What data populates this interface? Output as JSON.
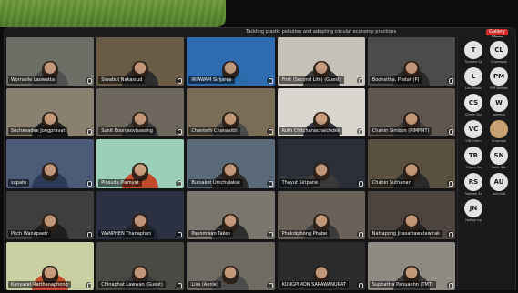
{
  "meeting": {
    "title": "Tackling plastic pollution and adopting circular economy practices",
    "view_label": "Gallery View"
  },
  "tiles": [
    {
      "name": "Worrasile Laowatta",
      "bg": "#6c6f66",
      "shirt": "#505050"
    },
    {
      "name": "Siwabut Nakasrud",
      "bg": "#6a5b47",
      "shirt": "#2d2d2d"
    },
    {
      "name": "IRIAWAM Sirijaree",
      "bg": "#2f6bb0",
      "shirt": "#2b6aa8"
    },
    {
      "name": "First (Second Life) (Guest)",
      "bg": "#c7c2b8",
      "shirt": "#3a3a3a"
    },
    {
      "name": "Boonsitha, Pratat (P)",
      "bg": "#4b4b4b",
      "shirt": "#2a2a2a"
    },
    {
      "name": "Suchavadee Jongpravat",
      "bg": "#8a8070",
      "shirt": "#1f1f1f"
    },
    {
      "name": "Sunit Boonjaovisasong",
      "bg": "#6e675e",
      "shirt": "#3c3c3c"
    },
    {
      "name": "Chanteth Chanakitti",
      "bg": "#7a6d58",
      "shirt": "#4a4a4a"
    },
    {
      "name": "Ruth Chitchanachaichoke",
      "bg": "#d9d6cf",
      "shirt": "#2f3440"
    },
    {
      "name": "Chanin Simbon (PIMPMT)",
      "bg": "#5f5650",
      "shirt": "#3a3a3a"
    },
    {
      "name": "supatn",
      "bg": "#4c5c78",
      "shirt": "#2c3a58"
    },
    {
      "name": "Pinsuda Plamyat",
      "bg": "#9ccfb8",
      "shirt": "#c04a2a"
    },
    {
      "name": "Butsakot Umchulakat",
      "bg": "#5a6a78",
      "shirt": "#2b2b2b"
    },
    {
      "name": "Thayut Siripane",
      "bg": "#2b2f37",
      "shirt": "#3a3a3a"
    },
    {
      "name": "Chanin Suthanan",
      "bg": "#5a5040",
      "shirt": "#2a2a2a"
    },
    {
      "name": "Pitch Wanapaetr",
      "bg": "#3e3e3e",
      "shirt": "#1e1e1e"
    },
    {
      "name": "WANPHEN Thanaphon",
      "bg": "#2b3142",
      "shirt": "#1e2430"
    },
    {
      "name": "Panomwan Takes",
      "bg": "#7b776f",
      "shirt": "#2d2d2d"
    },
    {
      "name": "Phakdiphong Phabe",
      "bg": "#6a6158",
      "shirt": "#3b3b3b"
    },
    {
      "name": "Nattapong Jirasattawatawirak",
      "bg": "#4e4540",
      "shirt": "#202020"
    },
    {
      "name": "Kanyarat Ratthanaphong",
      "bg": "#c9cfa0",
      "shirt": "#c64f2c"
    },
    {
      "name": "Chinaphat Lawwan (Guest)",
      "bg": "#4a4a44",
      "shirt": "#3a3a3a"
    },
    {
      "name": "Lisa (Annie)",
      "bg": "#6f6a62",
      "shirt": "#4b4b4b"
    },
    {
      "name": "KUNGPIMON SARAWANURAT",
      "bg": "#2b2b2b",
      "shirt": "#2a2a2a"
    },
    {
      "name": "Suphattra Panuanhn (TMT)",
      "bg": "#8f8b83",
      "shirt": "#3a3a3a"
    }
  ],
  "participants": [
    {
      "initials": "T",
      "name": "Tuvashe Sk",
      "color": "#e3e3e3"
    },
    {
      "initials": "CL",
      "name": "Chonlapat",
      "color": "#e3e3e3"
    },
    {
      "initials": "L",
      "name": "Lux Bhalik",
      "color": "#e3e3e3"
    },
    {
      "initials": "PM",
      "name": "PIM Mahrat",
      "color": "#e3e3e3"
    },
    {
      "initials": "CS",
      "name": "Charin Sur",
      "color": "#e7e7e7"
    },
    {
      "initials": "W",
      "name": "woseng",
      "color": "#e3e3e3"
    },
    {
      "initials": "VC",
      "name": "VIN Charn",
      "color": "#e3e3e3"
    },
    {
      "initials": "",
      "name": "Smorvpa",
      "color": "#c9a273"
    },
    {
      "initials": "TR",
      "name": "Thawn Ra",
      "color": "#e3e3e3"
    },
    {
      "initials": "SN",
      "name": "Sunit Nak",
      "color": "#e3e3e3"
    },
    {
      "initials": "RS",
      "name": "Rakkaw Sa",
      "color": "#e3e3e3"
    },
    {
      "initials": "AU",
      "name": "Annuhat",
      "color": "#e3e3e3"
    },
    {
      "initials": "JN",
      "name": "Nattap ng",
      "color": "#e3e3e3"
    }
  ]
}
